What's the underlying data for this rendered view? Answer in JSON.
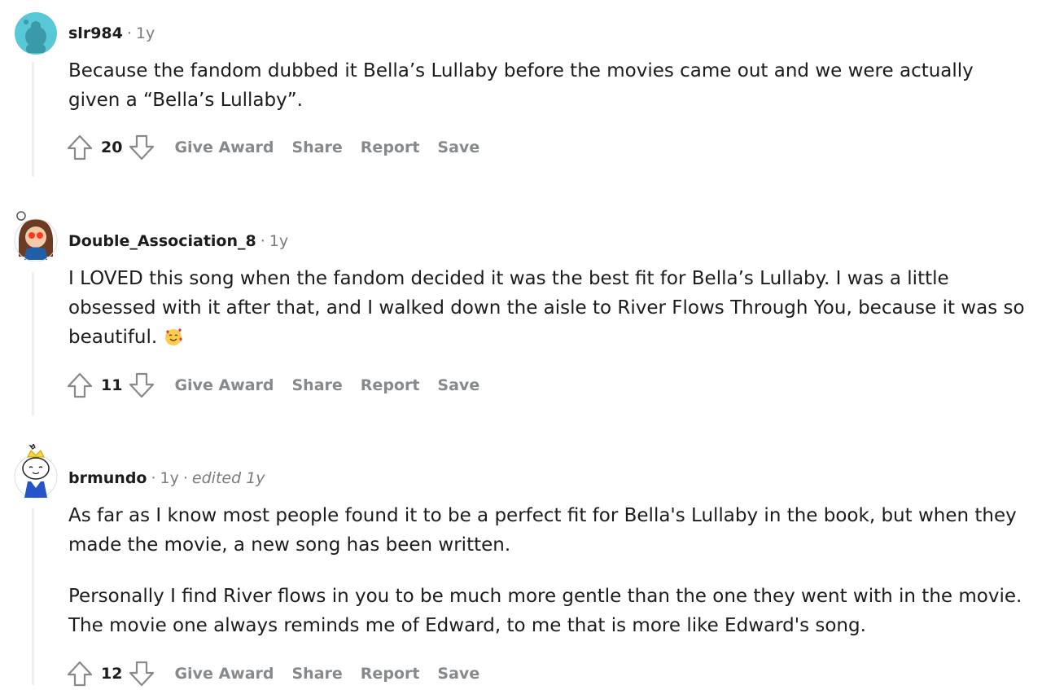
{
  "comments": [
    {
      "author": "slr984",
      "time": "1y",
      "edited": "",
      "paragraphs": [
        "Because the fandom dubbed it Bella’s Lullaby before the movies came out and we were actually given a “Bella’s Lullaby”."
      ],
      "score": "20",
      "actions": {
        "give_award": "Give Award",
        "share": "Share",
        "report": "Report",
        "save": "Save"
      }
    },
    {
      "author": "Double_Association_8",
      "time": "1y",
      "edited": "",
      "paragraphs": [
        "I LOVED this song when the fandom decided it was the best fit for Bella’s Lullaby. I was a little obsessed with it after that, and I walked down the aisle to River Flows Through You, because it was so beautiful."
      ],
      "emoji": "smiling-face-with-hearts",
      "score": "11",
      "actions": {
        "give_award": "Give Award",
        "share": "Share",
        "report": "Report",
        "save": "Save"
      }
    },
    {
      "author": "brmundo",
      "time": "1y",
      "edited": "edited 1y",
      "paragraphs": [
        "As far as I know most people found it to be a perfect fit for Bella's Lullaby in the book, but when they made the movie, a new song has been written.",
        "Personally I find River flows in you to be much more gentle than the one they went with in the movie. The movie one always reminds me of Edward, to me that is more like Edward's song."
      ],
      "score": "12",
      "actions": {
        "give_award": "Give Award",
        "share": "Share",
        "report": "Report",
        "save": "Save"
      }
    }
  ],
  "icons": {
    "upvote": "upvote-arrow-icon",
    "downvote": "downvote-arrow-icon"
  },
  "colors": {
    "action_text": "#878a8c",
    "meta_text": "#7c7c7c",
    "thread_line": "#edeff1"
  }
}
